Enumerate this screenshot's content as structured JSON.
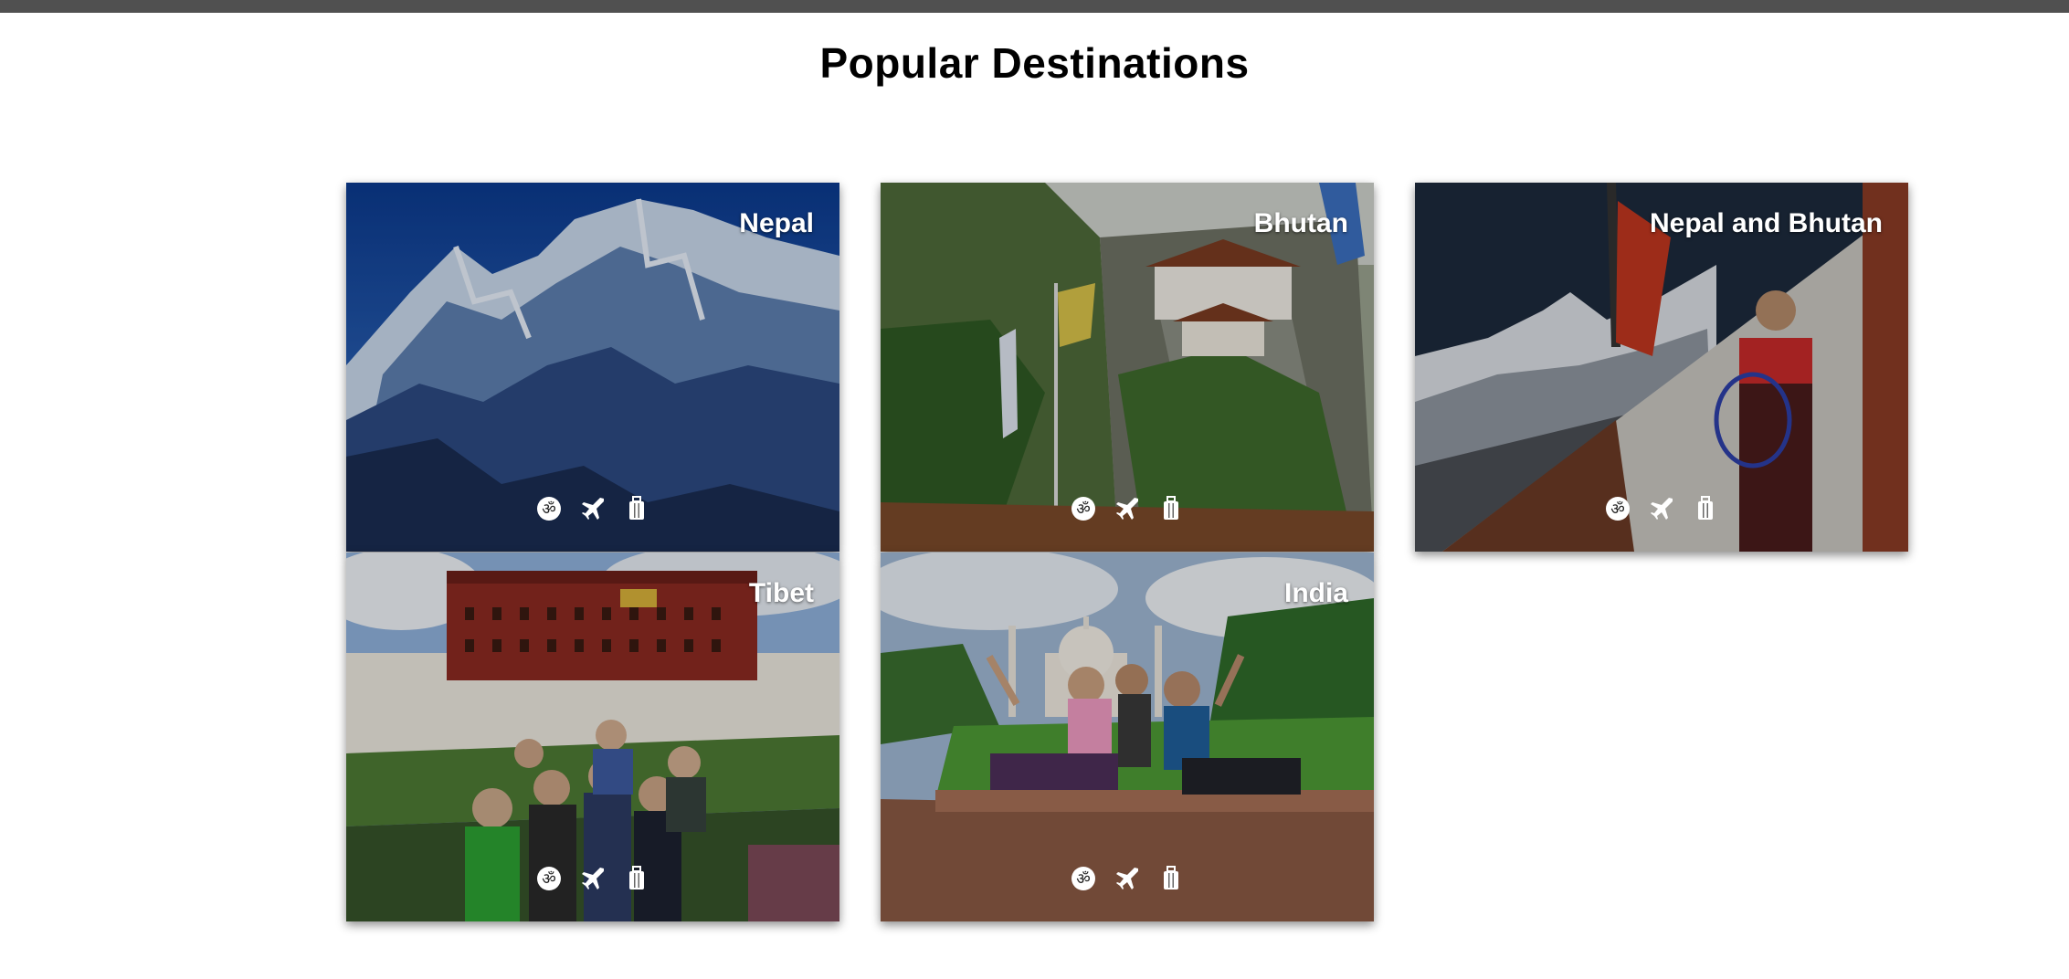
{
  "page": {
    "title": "Popular Destinations"
  },
  "destinations": [
    {
      "name": "Nepal"
    },
    {
      "name": "Bhutan"
    },
    {
      "name": "Nepal and Bhutan"
    },
    {
      "name": "Tibet"
    },
    {
      "name": "India"
    }
  ],
  "card_icons": [
    "om-icon",
    "airplane-icon",
    "luggage-icon"
  ],
  "colors": {
    "topbar": "#505050",
    "title_text": "#000000",
    "card_text": "#ffffff"
  }
}
